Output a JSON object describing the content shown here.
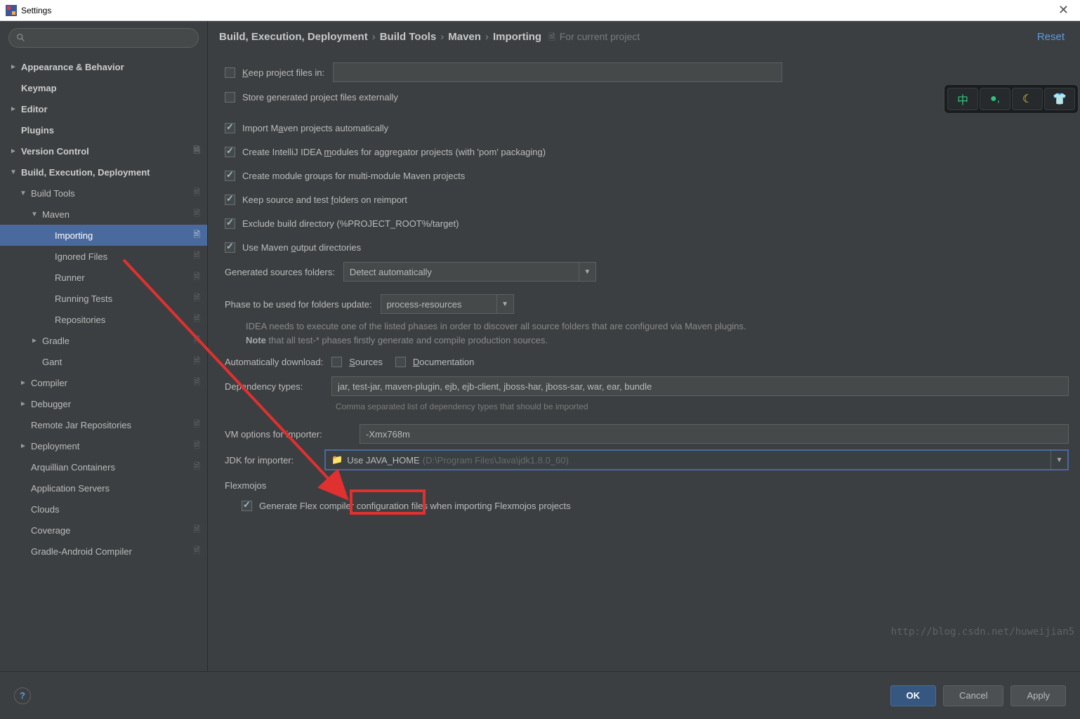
{
  "window": {
    "title": "Settings"
  },
  "search": {
    "placeholder": ""
  },
  "sidebar": {
    "items": [
      {
        "label": "Appearance & Behavior",
        "arrow": "►",
        "bold": true,
        "depth": 0
      },
      {
        "label": "Keymap",
        "arrow": "",
        "bold": true,
        "depth": 0
      },
      {
        "label": "Editor",
        "arrow": "►",
        "bold": true,
        "depth": 0
      },
      {
        "label": "Plugins",
        "arrow": "",
        "bold": true,
        "depth": 0
      },
      {
        "label": "Version Control",
        "arrow": "►",
        "bold": true,
        "depth": 0,
        "icon": true
      },
      {
        "label": "Build, Execution, Deployment",
        "arrow": "▼",
        "bold": true,
        "depth": 0
      },
      {
        "label": "Build Tools",
        "arrow": "▼",
        "bold": false,
        "depth": 1,
        "icon": true
      },
      {
        "label": "Maven",
        "arrow": "▼",
        "bold": false,
        "depth": 2,
        "icon": true
      },
      {
        "label": "Importing",
        "arrow": "",
        "bold": false,
        "depth": 3,
        "icon": true,
        "selected": true
      },
      {
        "label": "Ignored Files",
        "arrow": "",
        "bold": false,
        "depth": 3,
        "icon": true
      },
      {
        "label": "Runner",
        "arrow": "",
        "bold": false,
        "depth": 3,
        "icon": true
      },
      {
        "label": "Running Tests",
        "arrow": "",
        "bold": false,
        "depth": 3,
        "icon": true
      },
      {
        "label": "Repositories",
        "arrow": "",
        "bold": false,
        "depth": 3,
        "icon": true
      },
      {
        "label": "Gradle",
        "arrow": "►",
        "bold": false,
        "depth": 2,
        "icon": true
      },
      {
        "label": "Gant",
        "arrow": "",
        "bold": false,
        "depth": 2,
        "icon": true
      },
      {
        "label": "Compiler",
        "arrow": "►",
        "bold": false,
        "depth": 1,
        "icon": true
      },
      {
        "label": "Debugger",
        "arrow": "►",
        "bold": false,
        "depth": 1
      },
      {
        "label": "Remote Jar Repositories",
        "arrow": "",
        "bold": false,
        "depth": 1,
        "icon": true
      },
      {
        "label": "Deployment",
        "arrow": "►",
        "bold": false,
        "depth": 1,
        "icon": true
      },
      {
        "label": "Arquillian Containers",
        "arrow": "",
        "bold": false,
        "depth": 1,
        "icon": true
      },
      {
        "label": "Application Servers",
        "arrow": "",
        "bold": false,
        "depth": 1
      },
      {
        "label": "Clouds",
        "arrow": "",
        "bold": false,
        "depth": 1
      },
      {
        "label": "Coverage",
        "arrow": "",
        "bold": false,
        "depth": 1,
        "icon": true
      },
      {
        "label": "Gradle-Android Compiler",
        "arrow": "",
        "bold": false,
        "depth": 1,
        "icon": true
      }
    ]
  },
  "breadcrumb": {
    "p1": "Build, Execution, Deployment",
    "p2": "Build Tools",
    "p3": "Maven",
    "p4": "Importing",
    "scope": "For current project"
  },
  "reset_label": "Reset",
  "form": {
    "keep_project_files": "Keep project files in:",
    "store_externally": "Store generated project files externally",
    "import_auto": "Import Maven projects automatically",
    "create_modules": "Create IntelliJ IDEA modules for aggregator projects (with 'pom' packaging)",
    "create_groups": "Create module groups for multi-module Maven projects",
    "keep_source": "Keep source and test folders on reimport",
    "exclude_build": "Exclude build directory (%PROJECT_ROOT%/target)",
    "use_output": "Use Maven output directories",
    "gen_sources_label": "Generated sources folders:",
    "gen_sources_value": "Detect automatically",
    "phase_label": "Phase to be used for folders update:",
    "phase_value": "process-resources",
    "phase_note1": "IDEA needs to execute one of the listed phases in order to discover all source folders that are configured via Maven plugins.",
    "phase_note2_a": "Note",
    "phase_note2_b": " that all test-* phases firstly generate and compile production sources.",
    "auto_download_label": "Automatically download:",
    "sources_label": "Sources",
    "docs_label": "Documentation",
    "dep_types_label": "Dependency types:",
    "dep_types_value": "jar, test-jar, maven-plugin, ejb, ejb-client, jboss-har, jboss-sar, war, ear, bundle",
    "dep_hint": "Comma separated list of dependency types that should be imported",
    "vm_label": "VM options for importer:",
    "vm_value": "-Xmx768m",
    "jdk_label": "JDK for importer:",
    "jdk_value": "Use JAVA_HOME",
    "jdk_hint": "(D:\\Program Files\\Java\\jdk1.8.0_60)",
    "flexmojos_label": "Flexmojos",
    "flex_gen": "Generate Flex compiler configuration files when importing Flexmojos projects"
  },
  "buttons": {
    "ok": "OK",
    "cancel": "Cancel",
    "apply": "Apply",
    "help": "?"
  },
  "watermark": "http://blog.csdn.net/huweijian5",
  "float_tool": {
    "b1": "中",
    "b2": "●,",
    "b3": "☾",
    "b4": "👕"
  }
}
